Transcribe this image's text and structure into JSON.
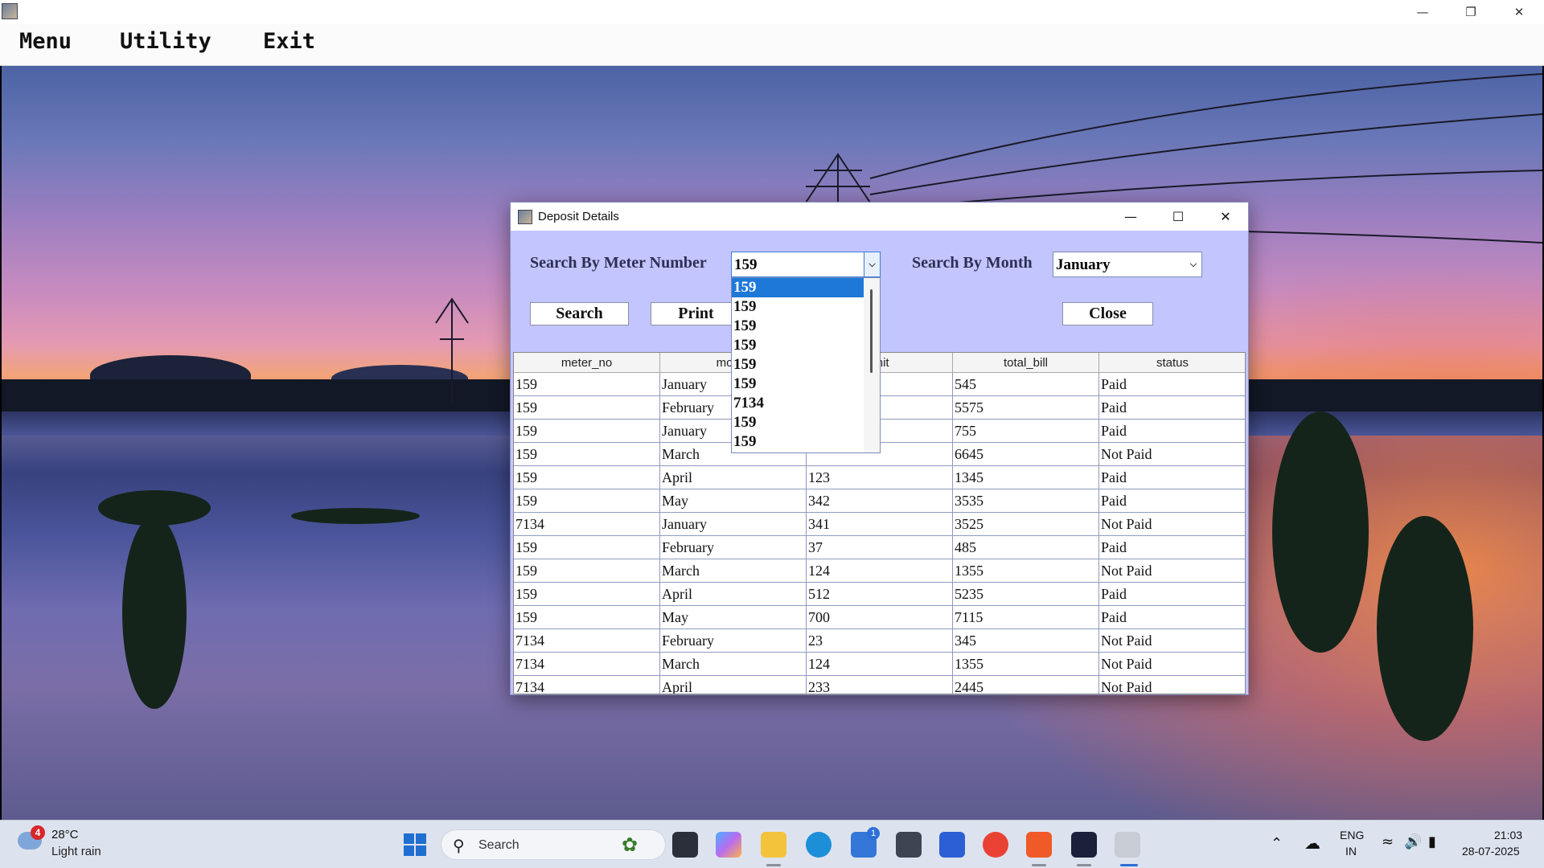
{
  "window": {
    "minimize": "—",
    "maximize": "❐",
    "close": "✕"
  },
  "menu": {
    "items": [
      "Menu",
      "Utility",
      "Exit"
    ]
  },
  "dialog": {
    "title": "Deposit Details",
    "controls": {
      "minimize": "—",
      "maximize": "☐",
      "close": "✕"
    },
    "search_meter_label": "Search By Meter Number",
    "meter_value": "159",
    "search_month_label": "Search By Month",
    "month_value": "January",
    "buttons": {
      "search": "Search",
      "print": "Print",
      "close": "Close"
    },
    "dropdown_options": [
      "159",
      "159",
      "159",
      "159",
      "159",
      "159",
      "7134",
      "159",
      "159"
    ],
    "table": {
      "columns": [
        "meter_no",
        "month",
        "unit",
        "total_bill",
        "status"
      ],
      "rows": [
        [
          "159",
          "January",
          "",
          "545",
          "Paid"
        ],
        [
          "159",
          "February",
          "",
          "5575",
          "Paid"
        ],
        [
          "159",
          "January",
          "",
          "755",
          "Paid"
        ],
        [
          "159",
          "March",
          "",
          "6645",
          "Not Paid"
        ],
        [
          "159",
          "April",
          "123",
          "1345",
          "Paid"
        ],
        [
          "159",
          "May",
          "342",
          "3535",
          "Paid"
        ],
        [
          "7134",
          "January",
          "341",
          "3525",
          "Not Paid"
        ],
        [
          "159",
          "February",
          "37",
          "485",
          "Paid"
        ],
        [
          "159",
          "March",
          "124",
          "1355",
          "Not Paid"
        ],
        [
          "159",
          "April",
          "512",
          "5235",
          "Paid"
        ],
        [
          "159",
          "May",
          "700",
          "7115",
          "Paid"
        ],
        [
          "7134",
          "February",
          "23",
          "345",
          "Not Paid"
        ],
        [
          "7134",
          "March",
          "124",
          "1355",
          "Not Paid"
        ],
        [
          "7134",
          "April",
          "233",
          "2445",
          "Not Paid"
        ]
      ]
    }
  },
  "taskbar": {
    "weather_alerts": "4",
    "temperature": "28°C",
    "condition": "Light rain",
    "search_placeholder": "Search",
    "store_badge": "1",
    "language": "ENG",
    "region": "IN",
    "time": "21:03",
    "date": "28-07-2025"
  },
  "colors": {
    "dialog_bg": "#c3c5ff",
    "selection": "#1e78d7",
    "label_text": "#2c3054"
  }
}
